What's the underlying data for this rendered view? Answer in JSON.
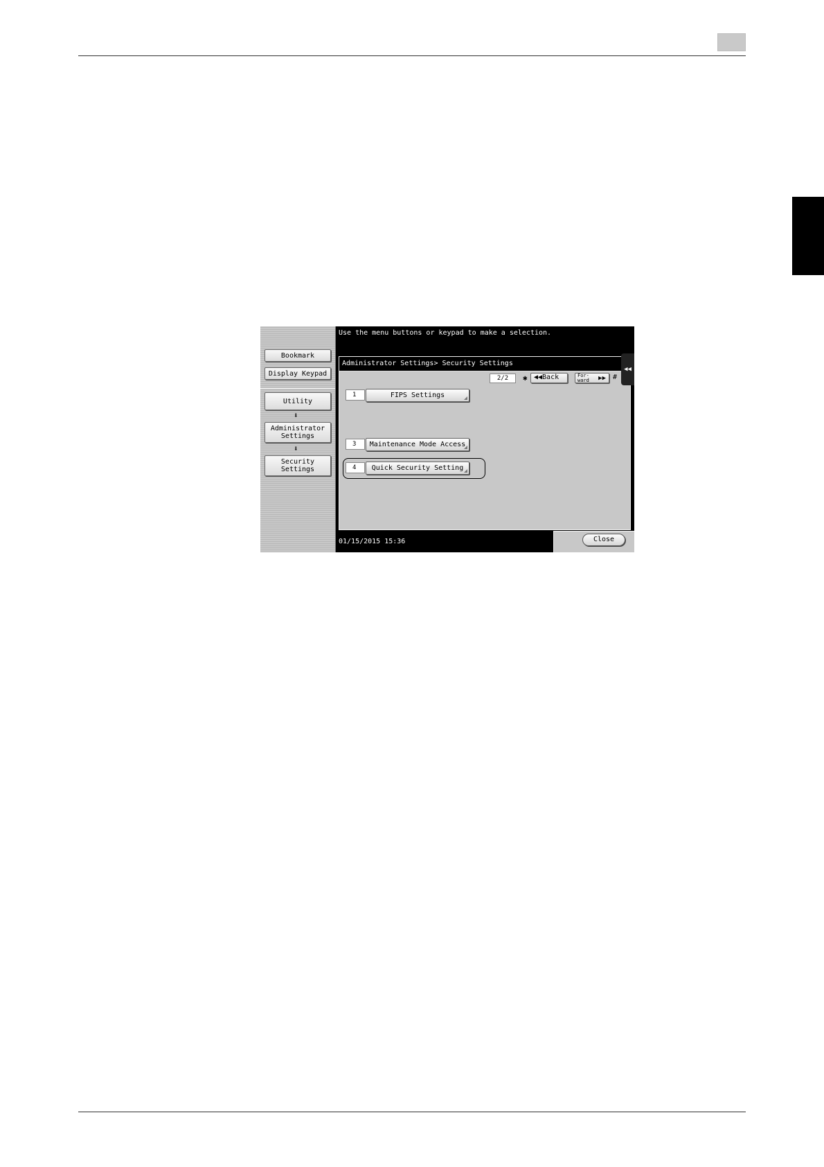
{
  "left_pane": {
    "bookmark": "Bookmark",
    "display_keypad": "Display Keypad",
    "utility": "Utility",
    "admin_line1": "Administrator",
    "admin_line2": "Settings",
    "security_line1": "Security",
    "security_line2": "Settings",
    "arrow": "⬇"
  },
  "prompt": "Use the menu buttons or keypad to make a selection.",
  "breadcrumb": "Administrator Settings> Security Settings",
  "pager": {
    "page": "2/2",
    "star": "✱",
    "back": "◀◀Back",
    "forward_line1": "For-",
    "forward_line2": "ward",
    "forward_arrow": "▶▶",
    "hash": "#"
  },
  "menu": [
    {
      "num": "1",
      "label": "FIPS Settings"
    },
    {
      "num": "3",
      "label": "Maintenance Mode Access"
    },
    {
      "num": "4",
      "label": "Quick Security Setting"
    }
  ],
  "collapse_icon": "◀◀",
  "datetime": "01/15/2015  15:36",
  "close": "Close"
}
